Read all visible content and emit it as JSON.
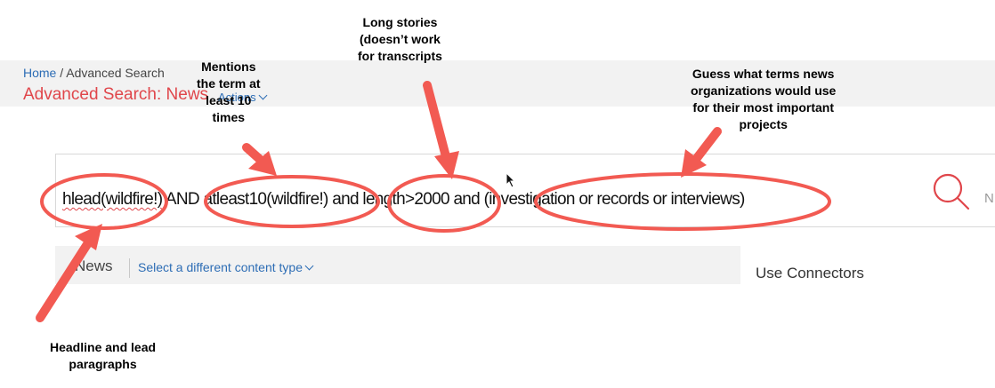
{
  "breadcrumb": {
    "home": "Home",
    "separator": " / ",
    "current": "Advanced Search"
  },
  "page": {
    "title": "Advanced Search: News",
    "actions_label": "Actions"
  },
  "search": {
    "query_parts": [
      "hlead(wildfire!)",
      " AND ",
      "atleast10(wildfire!)",
      " and ",
      "length>2000",
      " and ",
      "(investigation or records or interviews)"
    ],
    "search_button_icon": "search-icon",
    "cutoff_label": "N"
  },
  "content_type": {
    "label": "News",
    "change_link": "Select a different content type"
  },
  "sidebar": {
    "use_connectors": "Use Connectors"
  },
  "annotations": {
    "headline": [
      "Headline and lead",
      "paragraphs"
    ],
    "atleast": [
      "Mentions",
      "the term at",
      "least 10",
      "times"
    ],
    "length": [
      "Long stories",
      "(doesn’t work",
      "for transcripts"
    ],
    "terms": [
      "Guess what terms news",
      "organizations would use",
      "for their most important",
      "projects"
    ]
  },
  "colors": {
    "accent_red": "#e0464b",
    "link_blue": "#2d6db5",
    "arrow_red": "#f25a52"
  }
}
